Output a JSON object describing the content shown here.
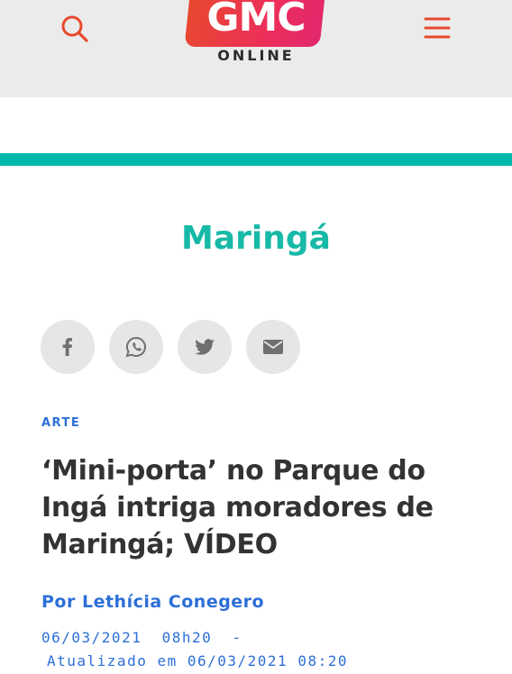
{
  "header": {
    "logo_main": "GMC",
    "logo_sub": "ONLINE",
    "search_icon": "search-icon",
    "menu_icon": "hamburger-menu-icon",
    "accent_color": "#e8492d"
  },
  "section": {
    "title": "Maringá",
    "color": "#17b9a7"
  },
  "share": {
    "buttons": [
      {
        "icon": "facebook-icon"
      },
      {
        "icon": "whatsapp-icon"
      },
      {
        "icon": "twitter-icon"
      },
      {
        "icon": "email-icon"
      }
    ]
  },
  "article": {
    "category": "ARTE",
    "headline": "‘Mini-porta’ no Parque do Ingá intriga moradores de Maringá; VÍDEO",
    "author": "Por Lethícia Conegero",
    "published": "06/03/2021  08h20  -",
    "updated": "Atualizado em 06/03/2021 08:20",
    "link_color": "#2c6fd7"
  }
}
